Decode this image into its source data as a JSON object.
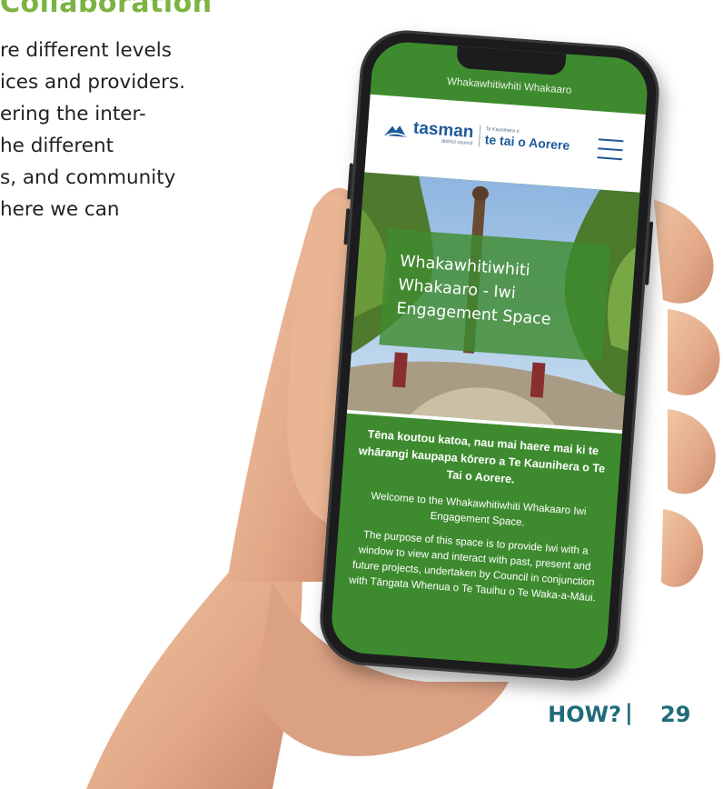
{
  "document": {
    "heading": "Collaboration",
    "body_lines": [
      "re different levels",
      "ices and providers.",
      "ering the inter-",
      "he different",
      "s, and community",
      "here we can"
    ],
    "footer": {
      "section": "HOW?",
      "separator": "|",
      "page_number": "29"
    }
  },
  "phone_screen": {
    "topbar_title": "Whakawhitiwhiti Whakaaro",
    "logo": {
      "brand_word": "tasman",
      "brand_sub": "district council",
      "maori_small": "Te Kaunihera o",
      "maori_name": "te tai o Aorere"
    },
    "menu_icon": "hamburger-icon",
    "hero": {
      "title_lines": [
        "Whakawhitiwhiti",
        "Whakaaro - Iwi",
        "Engagement Space"
      ]
    },
    "greeting": "Tēna koutou katoa, nau mai haere mai ki te whārangi kaupapa kōrero a Te Kaunihera o Te Tai o Aorere.",
    "welcome": "Welcome to the Whakawhitiwhiti Whakaaro Iwi Engagement Space.",
    "purpose": "The purpose of this space is to provide Iwi with a window to view and interact with past, present and future projects, undertaken by Council in conjunction with Tāngata Whenua o Te Tauihu o Te Waka-a-Māui."
  },
  "colors": {
    "heading_green": "#7cb342",
    "site_green": "#3e8b2f",
    "footer_teal": "#1f6b7a",
    "logo_blue": "#1f5a9a",
    "phone_black": "#1c1c1e"
  }
}
